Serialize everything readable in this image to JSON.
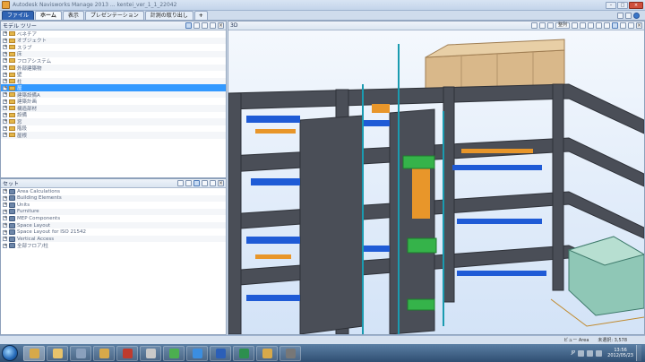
{
  "window": {
    "title": "Autodesk Navisworks Manage 2013   ...   kentei_ver_1_1_22042"
  },
  "ribbon": {
    "tabs": [
      {
        "label": "ファイル",
        "kind": "file"
      },
      {
        "label": "ホーム",
        "kind": "active"
      },
      {
        "label": "表示",
        "kind": "normal"
      },
      {
        "label": "プレゼンテーション",
        "kind": "normal"
      },
      {
        "label": "計測の取り出し",
        "kind": "normal"
      },
      {
        "label": "+",
        "kind": "plus"
      }
    ]
  },
  "model_tree": {
    "title": "モデル ツリー",
    "items": [
      {
        "label": "ベネチア"
      },
      {
        "label": "オブジェクト"
      },
      {
        "label": "スラブ"
      },
      {
        "label": "床"
      },
      {
        "label": "フロアシステム"
      },
      {
        "label": "外部建築物"
      },
      {
        "label": "壁"
      },
      {
        "label": "柱"
      },
      {
        "label": "屋",
        "selected": true
      },
      {
        "label": "建築設備A"
      },
      {
        "label": "建築計画"
      },
      {
        "label": "構造部材"
      },
      {
        "label": "設備"
      },
      {
        "label": "窓"
      },
      {
        "label": "階段"
      },
      {
        "label": "屋根"
      }
    ]
  },
  "sets": {
    "title": "セット",
    "items": [
      {
        "label": "Area Calculations"
      },
      {
        "label": "Building Elements"
      },
      {
        "label": "Units"
      },
      {
        "label": "Furniture"
      },
      {
        "label": "MEP Components"
      },
      {
        "label": "Space Layout"
      },
      {
        "label": "Space Layout for ISO 21542"
      },
      {
        "label": "Vertical Access"
      },
      {
        "label": "全部フロア/柱"
      }
    ]
  },
  "viewport": {
    "title": "3D",
    "zoom_label": "整列"
  },
  "status": {
    "left": "ビュー Area",
    "right": "未選択: 3,578"
  },
  "taskbar": {
    "apps": [
      {
        "name": "navisworks-app",
        "color": "#d7a94a",
        "active": true
      },
      {
        "name": "explorer-app",
        "color": "#e8c36b"
      },
      {
        "name": "media-app",
        "color": "#8aa0bd"
      },
      {
        "name": "viewer-app",
        "color": "#d7a94a"
      },
      {
        "name": "cad-app",
        "color": "#bf3b2e"
      },
      {
        "name": "sketch-app",
        "color": "#c9c9c9"
      },
      {
        "name": "chrome-app",
        "color": "#4caf50"
      },
      {
        "name": "ie-app",
        "color": "#3b8ee0"
      },
      {
        "name": "word-app",
        "color": "#2b5fb8"
      },
      {
        "name": "excel-app",
        "color": "#2d8f4e"
      },
      {
        "name": "nav-app-2",
        "color": "#d7a94a"
      },
      {
        "name": "cad-app-2",
        "color": "#777"
      }
    ],
    "tray_lang": "JP",
    "time": "13:56",
    "date": "2012/05/23"
  }
}
